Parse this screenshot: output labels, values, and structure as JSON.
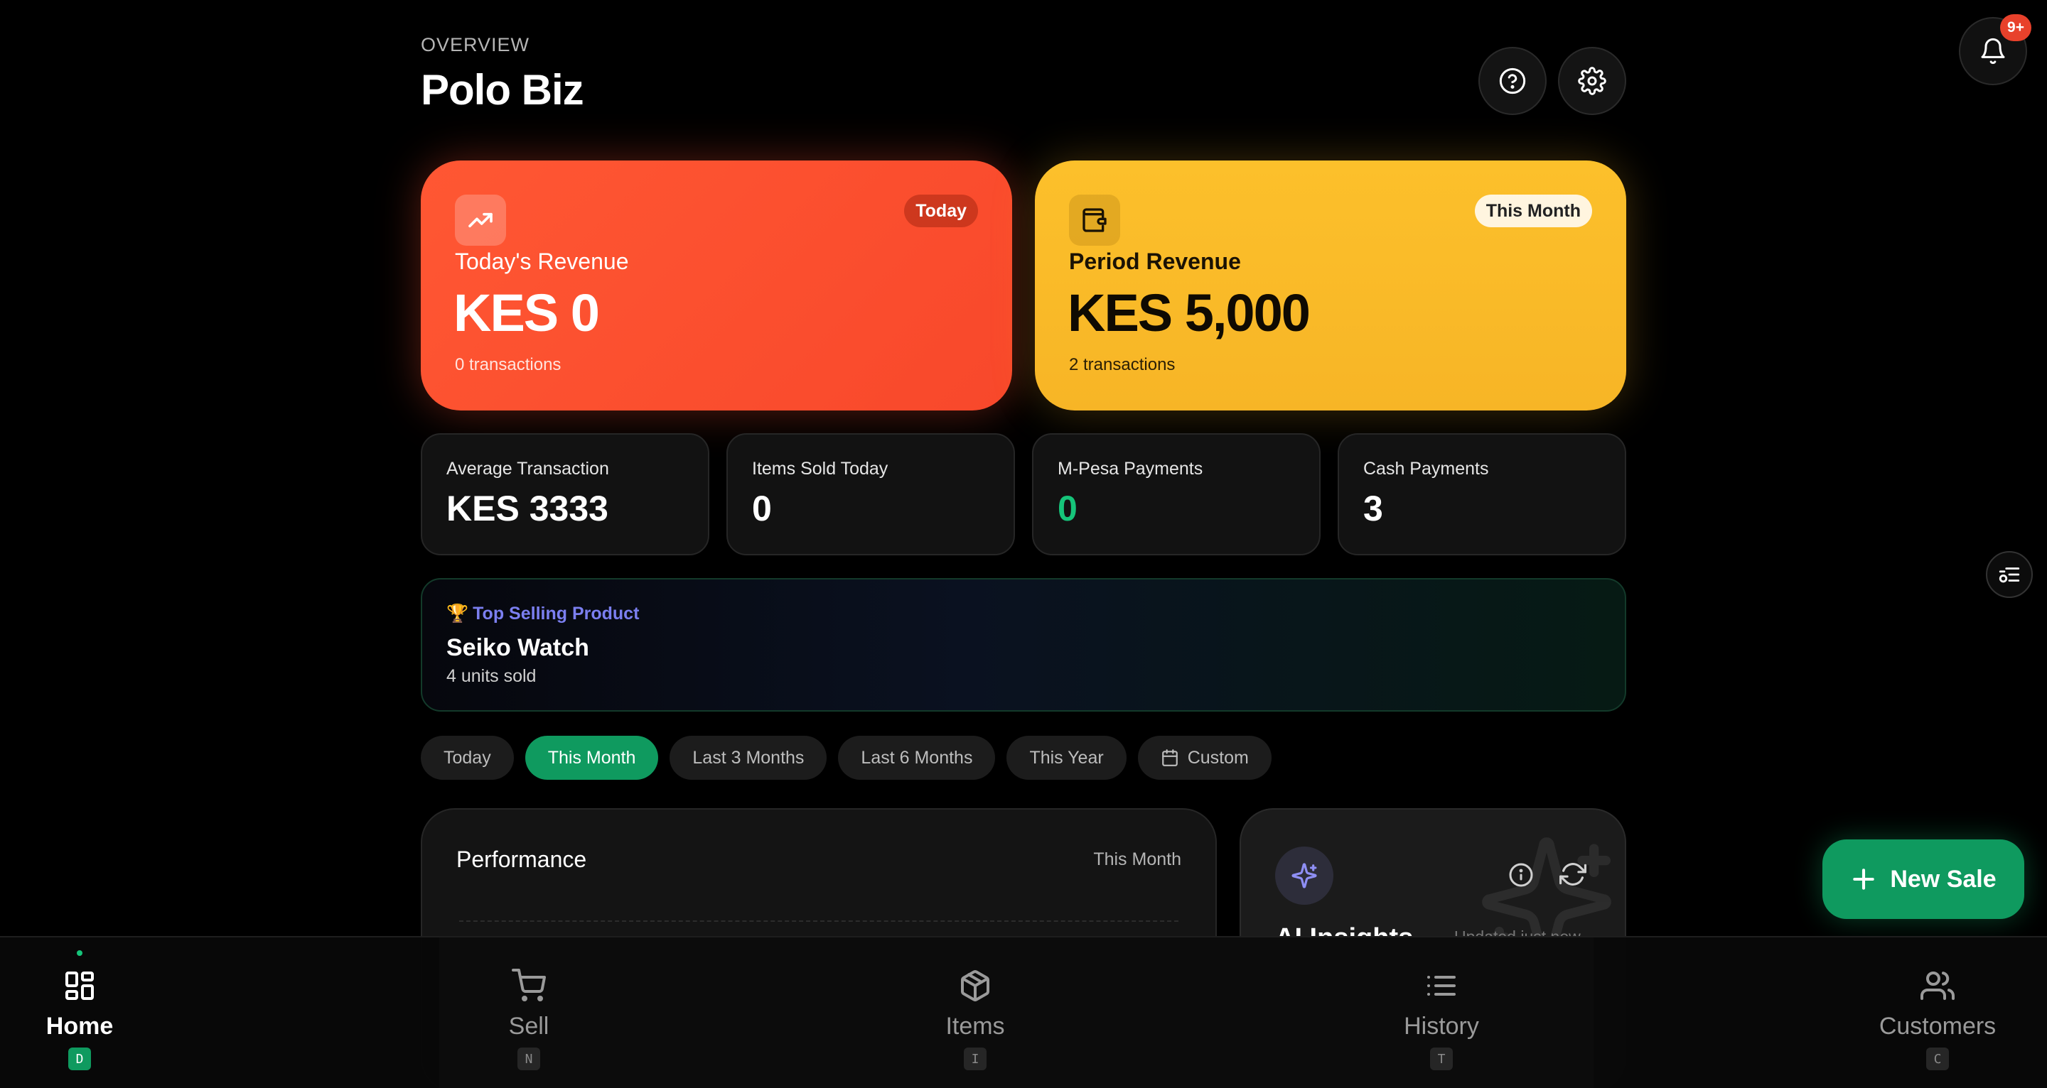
{
  "header": {
    "overline": "OVERVIEW",
    "title": "Polo Biz",
    "notifications_badge": "9+"
  },
  "revenue_cards": {
    "today": {
      "pill": "Today",
      "label": "Today's Revenue",
      "value": "KES 0",
      "sub": "0 transactions",
      "icon": "trending-up-icon",
      "color": "#ff5733"
    },
    "period": {
      "pill": "This Month",
      "label": "Period Revenue",
      "value": "KES 5,000",
      "sub": "2 transactions",
      "icon": "wallet-icon",
      "color": "#fcc02b"
    }
  },
  "stats": [
    {
      "label": "Average Transaction",
      "value": "KES 3333"
    },
    {
      "label": "Items Sold Today",
      "value": "0"
    },
    {
      "label": "M-Pesa Payments",
      "value": "0"
    },
    {
      "label": "Cash Payments",
      "value": "3"
    }
  ],
  "top_product": {
    "heading_icon": "🏆",
    "heading": "Top Selling Product",
    "name": "Seiko Watch",
    "sub": "4 units sold"
  },
  "filters": {
    "options": [
      "Today",
      "This Month",
      "Last 3 Months",
      "Last 6 Months",
      "This Year",
      "Custom"
    ],
    "selected": "This Month"
  },
  "performance": {
    "title": "Performance",
    "period": "This Month"
  },
  "ai_insights": {
    "title": "AI Insights",
    "updated": "Updated just now"
  },
  "fab": {
    "label": "New Sale"
  },
  "bottom_nav": [
    {
      "label": "Home",
      "key": "D",
      "icon": "grid-icon",
      "active": true
    },
    {
      "label": "Sell",
      "key": "N",
      "icon": "cart-icon"
    },
    {
      "label": "Items",
      "key": "I",
      "icon": "package-icon"
    },
    {
      "label": "History",
      "key": "T",
      "icon": "list-icon"
    },
    {
      "label": "Customers",
      "key": "C",
      "icon": "users-icon"
    }
  ],
  "colors": {
    "accent_green": "#0f9a5f",
    "mpesa_green": "#16c47a",
    "badge_red": "#e8412b",
    "insight_purple": "#7b7ff0"
  }
}
